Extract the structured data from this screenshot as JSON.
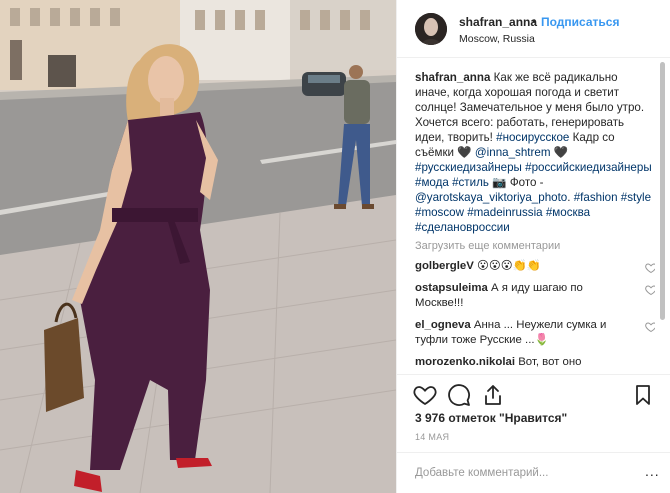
{
  "colors": {
    "link": "#003569",
    "follow": "#3897f0",
    "muted": "#999999",
    "text": "#262626",
    "dress": "#4a1f3f"
  },
  "header": {
    "username": "shafran_anna",
    "separator": "•",
    "follow_label": "Подписаться",
    "location": "Moscow, Russia"
  },
  "caption": {
    "username": "shafran_anna",
    "text": "Как же всё радикально иначе, когда хорошая погода и светит солнце! Замечательное у меня было утро. Хочется всего: работать, генерировать идеи, творить!",
    "tag1": "#носирусское",
    "text2": "Кадр со съёмки 🖤",
    "mention1": "@inna_shtrem",
    "heart": "🖤",
    "tag2": "#русскиедизайнеры",
    "tag3": "#российскиедизайнеры",
    "tag4": "#мода",
    "tag5": "#стиль",
    "camera": "📷",
    "photo_label": "Фото -",
    "mention2": "@yarotskaya_viktoriya_photo",
    "tag6": "#fashion",
    "tag7": "#style",
    "tag8": "#moscow",
    "tag9": "#madeinrussia",
    "tag10": "#москва",
    "tag11": "#сделановроссии"
  },
  "load_more": "Загрузить еще комментарии",
  "comments": [
    {
      "username": "golbergleV",
      "text": "😮😮😮👏👏"
    },
    {
      "username": "ostapsuleima",
      "text": "А я иду шагаю по Москве!!!"
    },
    {
      "username": "el_ogneva",
      "text": "Анна ... Неужели сумка и туфли тоже Русские ...🌷"
    },
    {
      "username": "morozenko.nikolai",
      "text": "Вот, вот оно самое!!!!!!! А когда рядом разные"
    }
  ],
  "icons": {
    "like": "heart-outline-icon",
    "comment": "speech-bubble-icon",
    "share": "share-upload-icon",
    "save": "bookmark-icon",
    "more": "more-dots-icon"
  },
  "likes": "3 976 отметок \"Нравится\"",
  "date": "14 МАЯ",
  "add_comment": {
    "placeholder": "Добавьте комментарий...",
    "more": "..."
  }
}
